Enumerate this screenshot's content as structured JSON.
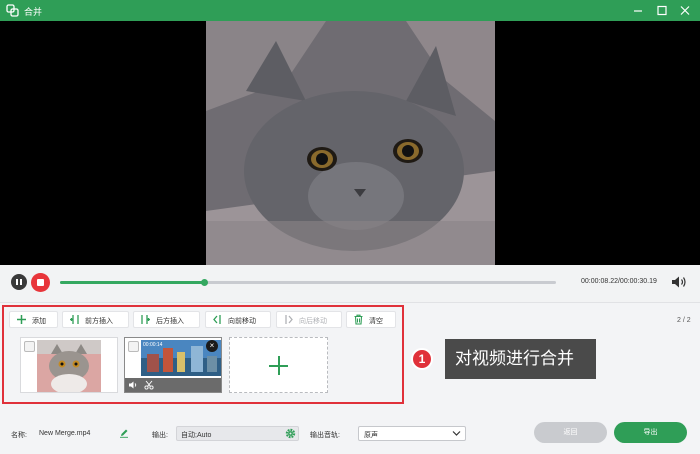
{
  "window": {
    "title": "合并",
    "icon": "merge-app-icon"
  },
  "player": {
    "current_time": "00:00:08.22",
    "total_time": "00:00:30.19",
    "time_display": "00:00:08.22/00:00:30.19",
    "progress": 0.29
  },
  "toolbar": {
    "add": "添加",
    "insert_before": "前方插入",
    "insert_after": "后方插入",
    "move_forward": "向前移动",
    "move_backward": "向后移动",
    "clear": "清空"
  },
  "pagination": "2 / 2",
  "clips": [
    {
      "name": "cat-clip"
    },
    {
      "name": "city-clip",
      "duration": "00:00:14"
    }
  ],
  "callout": {
    "number": "1",
    "text": "对视频进行合并"
  },
  "bottom": {
    "name_label": "名称:",
    "name_value": "New Merge.mp4",
    "output_label": "输出:",
    "output_value": "自动;Auto",
    "audio_label": "输出音轨:",
    "audio_value": "原声",
    "back_button": "返回",
    "export_button": "导出"
  },
  "colors": {
    "accent": "#2f9e57",
    "highlight": "#e0313a",
    "stop": "#e8353a"
  }
}
